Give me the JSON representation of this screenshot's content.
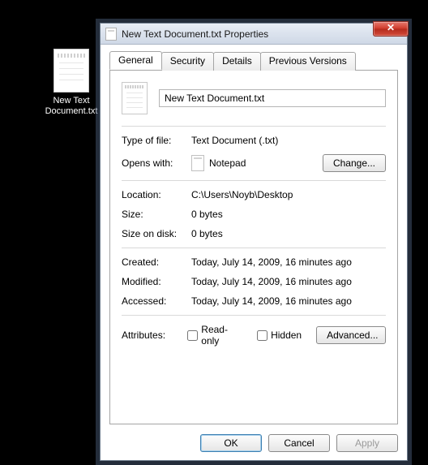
{
  "desktop": {
    "file_label": "New Text Document.txt"
  },
  "window": {
    "title": "New Text Document.txt Properties",
    "close_glyph": "✕"
  },
  "tabs": {
    "general": "General",
    "security": "Security",
    "details": "Details",
    "previous": "Previous Versions"
  },
  "general": {
    "filename": "New Text Document.txt",
    "type_label": "Type of file:",
    "type_value": "Text Document (.txt)",
    "opens_label": "Opens with:",
    "opens_value": "Notepad",
    "change_btn": "Change...",
    "location_label": "Location:",
    "location_value": "C:\\Users\\Noyb\\Desktop",
    "size_label": "Size:",
    "size_value": "0 bytes",
    "sizeondisk_label": "Size on disk:",
    "sizeondisk_value": "0 bytes",
    "created_label": "Created:",
    "created_value": "Today, July 14, 2009, 16 minutes ago",
    "modified_label": "Modified:",
    "modified_value": "Today, July 14, 2009, 16 minutes ago",
    "accessed_label": "Accessed:",
    "accessed_value": "Today, July 14, 2009, 16 minutes ago",
    "attributes_label": "Attributes:",
    "readonly_label": "Read-only",
    "hidden_label": "Hidden",
    "advanced_btn": "Advanced..."
  },
  "buttons": {
    "ok": "OK",
    "cancel": "Cancel",
    "apply": "Apply"
  }
}
